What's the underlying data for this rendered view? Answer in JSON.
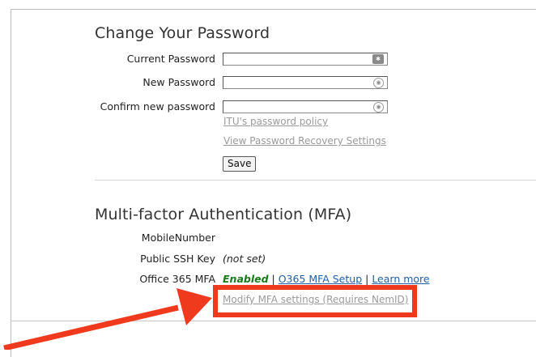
{
  "password_section": {
    "title": "Change Your Password",
    "current_label": "Current Password",
    "new_label": "New Password",
    "confirm_label": "Confirm new password",
    "policy_link": "ITU's password policy",
    "recovery_link": "View Password Recovery Settings",
    "save_label": "Save"
  },
  "mfa_section": {
    "title": "Multi-factor Authentication (MFA)",
    "mobile_label": "MobileNumber",
    "ssh_label": "Public SSH Key",
    "ssh_value": "(not set)",
    "o365_label": "Office 365 MFA",
    "o365_status": "Enabled",
    "separator": "|",
    "o365_setup_link": "O365 MFA Setup",
    "learn_more_link": "Learn more",
    "modify_link": "Modify MFA settings (Requires NemID)"
  },
  "icons": {
    "current_field_icon": "password-manager-key-icon",
    "new_field_icon": "password-reveal-icon",
    "confirm_field_icon": "password-reveal-icon"
  },
  "colors": {
    "annotation": "#f03a1e",
    "enabled": "#1a7a1a",
    "link": "#1f5fa8",
    "muted_link": "#9a9a9a"
  }
}
